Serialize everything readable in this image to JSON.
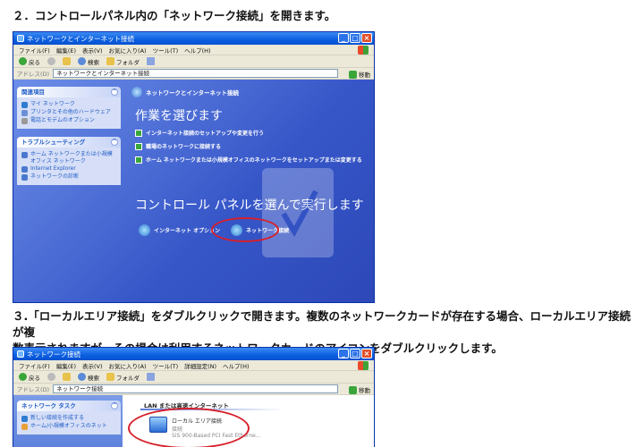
{
  "step2": "２．コントロールパネル内の「ネットワーク接続」を開きます。",
  "step3_line1": "３.「ローカルエリア接続」をダブルクリックで開きます。複数のネットワークカードが存在する場合、ローカルエリア接続が複",
  "step3_line2": "数表示されますが、その場合は利用するネットワークカードのアイコンをダブルクリックします。",
  "win1": {
    "title": "ネットワークとインターネット接続",
    "menu": [
      "ファイル(F)",
      "編集(E)",
      "表示(V)",
      "お気に入り(A)",
      "ツール(T)",
      "ヘルプ(H)"
    ],
    "toolbar": {
      "back": "戻る",
      "search": "検索",
      "folders": "フォルダ"
    },
    "address_label": "アドレス(D)",
    "address": "ネットワークとインターネット接続",
    "go": "移動",
    "related_title": "関連項目",
    "related_items": [
      "マイ ネットワーク",
      "プリンタとその他のハードウェア",
      "電話とモデムのオプション"
    ],
    "trouble_title": "トラブルシューティング",
    "trouble_items": [
      "ホーム ネットワークまたは小規模オフィス ネットワーク",
      "Internet Explorer",
      "ネットワークの診断"
    ],
    "header": "ネットワークとインターネット接続",
    "choose_task": "作業を選びます",
    "tasks": [
      "インターネット接続のセットアップや変更を行う",
      "職場のネットワークに接続する",
      "ホーム ネットワークまたは小規模オフィスのネットワークをセットアップまたは変更する"
    ],
    "choose_cp": "コントロール パネルを選んで実行します",
    "icons": [
      "インターネット オプション",
      "ネットワーク接続"
    ]
  },
  "win2": {
    "title": "ネットワーク接続",
    "menu": [
      "ファイル(F)",
      "編集(E)",
      "表示(V)",
      "お気に入り(A)",
      "ツール(T)",
      "詳細設定(N)",
      "ヘルプ(H)"
    ],
    "toolbar": {
      "back": "戻る",
      "search": "検索",
      "folders": "フォルダ"
    },
    "address_label": "アドレス(D)",
    "address": "ネットワーク接続",
    "go": "移動",
    "tasks_title": "ネットワーク タスク",
    "tasks": [
      "新しい接続を作成する",
      "ホーム/小規模オフィスのネット"
    ],
    "lan_header": "LAN または高速インターネット",
    "connection": {
      "name": "ローカル エリア接続",
      "status": "接続",
      "device": "SiS 900-Based PCI Fast Etherne..."
    }
  },
  "colors": {
    "xp_blue": "#0a5fe0",
    "highlight_red": "#d7202a"
  }
}
